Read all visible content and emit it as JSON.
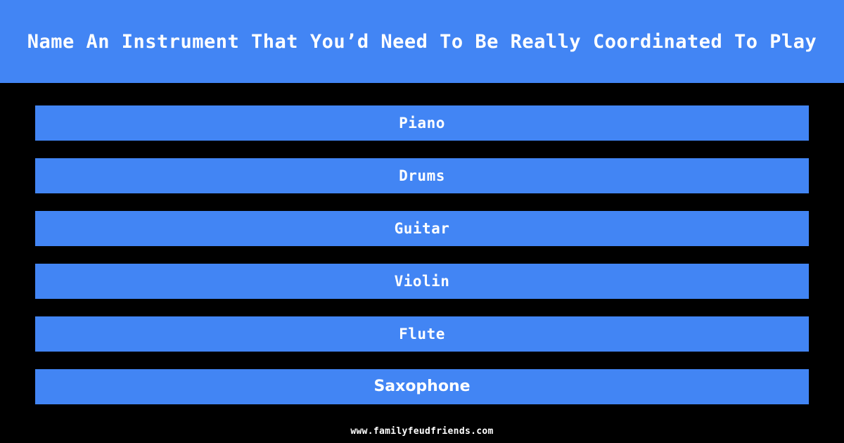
{
  "theme": {
    "background": "#000000",
    "accent": "#4285f4",
    "text": "#ffffff"
  },
  "header": {
    "title": "Name An Instrument That You’d Need To Be Really Coordinated To Play"
  },
  "answers": [
    {
      "label": "Piano"
    },
    {
      "label": "Drums"
    },
    {
      "label": "Guitar"
    },
    {
      "label": "Violin"
    },
    {
      "label": "Flute"
    },
    {
      "label": "Saxophone"
    }
  ],
  "footer": {
    "url": "www.familyfeudfriends.com"
  }
}
